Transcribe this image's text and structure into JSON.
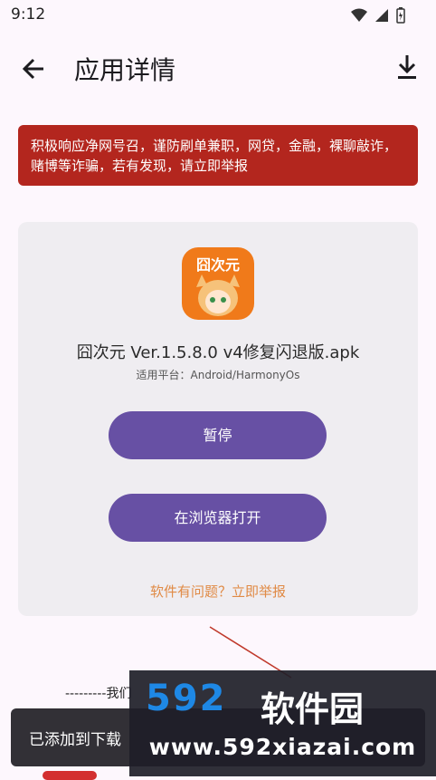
{
  "status_bar": {
    "time": "9:12"
  },
  "app_bar": {
    "title": "应用详情"
  },
  "warning": {
    "text": "积极响应净网号召，谨防刷单兼职，网贷，金融，裸聊敲诈，赌博等诈骗，若有发现，请立即举报"
  },
  "app": {
    "icon_text": "囧次元",
    "file_name": "囧次元 Ver.1.5.8.0  v4修复闪退版.apk",
    "platform": "适用平台：Android/HarmonyOs"
  },
  "buttons": {
    "pause": "暂停",
    "open_browser": "在浏览器打开"
  },
  "report_link": "软件有问题？立即举报",
  "below_text": "---------我们",
  "snackbar": {
    "text": "已添加到下载"
  },
  "watermark": {
    "brand_num": "592",
    "brand_cn": "软件园",
    "url": "www.592xiazai.com"
  },
  "colors": {
    "accent": "#6750a4",
    "warning": "#b3261e",
    "report": "#e08a45"
  }
}
